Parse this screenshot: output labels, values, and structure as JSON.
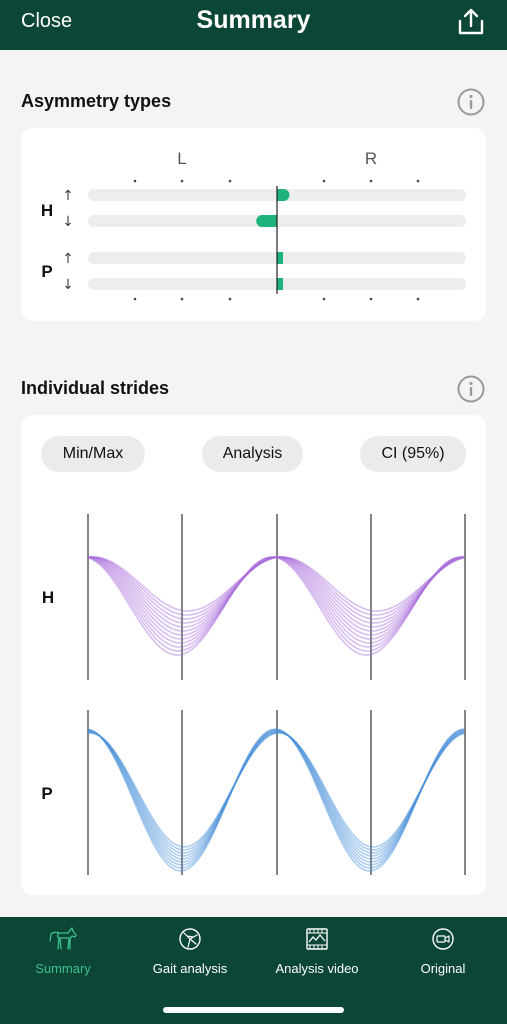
{
  "header": {
    "close_label": "Close",
    "title": "Summary",
    "share_icon": "share-icon"
  },
  "asymmetry": {
    "title": "Asymmetry types",
    "info_icon": "info-icon",
    "left_label": "L",
    "right_label": "R",
    "rows": [
      {
        "group": "H",
        "arrow": "↑",
        "value": 0.3
      },
      {
        "group": "H",
        "arrow": "↓",
        "value": -0.5
      },
      {
        "group": "P",
        "arrow": "↑",
        "value": 0.1
      },
      {
        "group": "P",
        "arrow": "↓",
        "value": 0.15
      }
    ],
    "bar_color": "#1db37a"
  },
  "strides": {
    "title": "Individual strides",
    "info_icon": "info-icon",
    "buttons": [
      "Min/Max",
      "Analysis",
      "CI (95%)"
    ],
    "h_label": "H",
    "p_label": "P",
    "h_color": "#a96ddc",
    "p_color": "#4a90d9"
  },
  "navbar": {
    "items": [
      {
        "label": "Summary",
        "icon": "horse-icon",
        "active": true
      },
      {
        "label": "Gait analysis",
        "icon": "gait-icon",
        "active": false
      },
      {
        "label": "Analysis video",
        "icon": "chart-video-icon",
        "active": false
      },
      {
        "label": "Original",
        "icon": "video-camera-icon",
        "active": false
      }
    ],
    "active_color": "#3fc08e"
  }
}
